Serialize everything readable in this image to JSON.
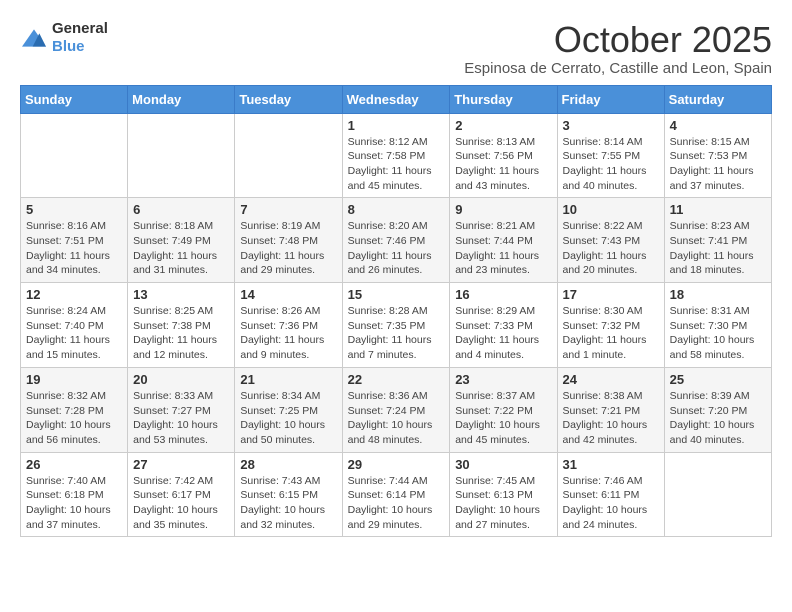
{
  "header": {
    "logo_general": "General",
    "logo_blue": "Blue",
    "month": "October 2025",
    "location": "Espinosa de Cerrato, Castille and Leon, Spain"
  },
  "weekdays": [
    "Sunday",
    "Monday",
    "Tuesday",
    "Wednesday",
    "Thursday",
    "Friday",
    "Saturday"
  ],
  "weeks": [
    [
      {
        "day": "",
        "info": ""
      },
      {
        "day": "",
        "info": ""
      },
      {
        "day": "",
        "info": ""
      },
      {
        "day": "1",
        "info": "Sunrise: 8:12 AM\nSunset: 7:58 PM\nDaylight: 11 hours and 45 minutes."
      },
      {
        "day": "2",
        "info": "Sunrise: 8:13 AM\nSunset: 7:56 PM\nDaylight: 11 hours and 43 minutes."
      },
      {
        "day": "3",
        "info": "Sunrise: 8:14 AM\nSunset: 7:55 PM\nDaylight: 11 hours and 40 minutes."
      },
      {
        "day": "4",
        "info": "Sunrise: 8:15 AM\nSunset: 7:53 PM\nDaylight: 11 hours and 37 minutes."
      }
    ],
    [
      {
        "day": "5",
        "info": "Sunrise: 8:16 AM\nSunset: 7:51 PM\nDaylight: 11 hours and 34 minutes."
      },
      {
        "day": "6",
        "info": "Sunrise: 8:18 AM\nSunset: 7:49 PM\nDaylight: 11 hours and 31 minutes."
      },
      {
        "day": "7",
        "info": "Sunrise: 8:19 AM\nSunset: 7:48 PM\nDaylight: 11 hours and 29 minutes."
      },
      {
        "day": "8",
        "info": "Sunrise: 8:20 AM\nSunset: 7:46 PM\nDaylight: 11 hours and 26 minutes."
      },
      {
        "day": "9",
        "info": "Sunrise: 8:21 AM\nSunset: 7:44 PM\nDaylight: 11 hours and 23 minutes."
      },
      {
        "day": "10",
        "info": "Sunrise: 8:22 AM\nSunset: 7:43 PM\nDaylight: 11 hours and 20 minutes."
      },
      {
        "day": "11",
        "info": "Sunrise: 8:23 AM\nSunset: 7:41 PM\nDaylight: 11 hours and 18 minutes."
      }
    ],
    [
      {
        "day": "12",
        "info": "Sunrise: 8:24 AM\nSunset: 7:40 PM\nDaylight: 11 hours and 15 minutes."
      },
      {
        "day": "13",
        "info": "Sunrise: 8:25 AM\nSunset: 7:38 PM\nDaylight: 11 hours and 12 minutes."
      },
      {
        "day": "14",
        "info": "Sunrise: 8:26 AM\nSunset: 7:36 PM\nDaylight: 11 hours and 9 minutes."
      },
      {
        "day": "15",
        "info": "Sunrise: 8:28 AM\nSunset: 7:35 PM\nDaylight: 11 hours and 7 minutes."
      },
      {
        "day": "16",
        "info": "Sunrise: 8:29 AM\nSunset: 7:33 PM\nDaylight: 11 hours and 4 minutes."
      },
      {
        "day": "17",
        "info": "Sunrise: 8:30 AM\nSunset: 7:32 PM\nDaylight: 11 hours and 1 minute."
      },
      {
        "day": "18",
        "info": "Sunrise: 8:31 AM\nSunset: 7:30 PM\nDaylight: 10 hours and 58 minutes."
      }
    ],
    [
      {
        "day": "19",
        "info": "Sunrise: 8:32 AM\nSunset: 7:28 PM\nDaylight: 10 hours and 56 minutes."
      },
      {
        "day": "20",
        "info": "Sunrise: 8:33 AM\nSunset: 7:27 PM\nDaylight: 10 hours and 53 minutes."
      },
      {
        "day": "21",
        "info": "Sunrise: 8:34 AM\nSunset: 7:25 PM\nDaylight: 10 hours and 50 minutes."
      },
      {
        "day": "22",
        "info": "Sunrise: 8:36 AM\nSunset: 7:24 PM\nDaylight: 10 hours and 48 minutes."
      },
      {
        "day": "23",
        "info": "Sunrise: 8:37 AM\nSunset: 7:22 PM\nDaylight: 10 hours and 45 minutes."
      },
      {
        "day": "24",
        "info": "Sunrise: 8:38 AM\nSunset: 7:21 PM\nDaylight: 10 hours and 42 minutes."
      },
      {
        "day": "25",
        "info": "Sunrise: 8:39 AM\nSunset: 7:20 PM\nDaylight: 10 hours and 40 minutes."
      }
    ],
    [
      {
        "day": "26",
        "info": "Sunrise: 7:40 AM\nSunset: 6:18 PM\nDaylight: 10 hours and 37 minutes."
      },
      {
        "day": "27",
        "info": "Sunrise: 7:42 AM\nSunset: 6:17 PM\nDaylight: 10 hours and 35 minutes."
      },
      {
        "day": "28",
        "info": "Sunrise: 7:43 AM\nSunset: 6:15 PM\nDaylight: 10 hours and 32 minutes."
      },
      {
        "day": "29",
        "info": "Sunrise: 7:44 AM\nSunset: 6:14 PM\nDaylight: 10 hours and 29 minutes."
      },
      {
        "day": "30",
        "info": "Sunrise: 7:45 AM\nSunset: 6:13 PM\nDaylight: 10 hours and 27 minutes."
      },
      {
        "day": "31",
        "info": "Sunrise: 7:46 AM\nSunset: 6:11 PM\nDaylight: 10 hours and 24 minutes."
      },
      {
        "day": "",
        "info": ""
      }
    ]
  ]
}
